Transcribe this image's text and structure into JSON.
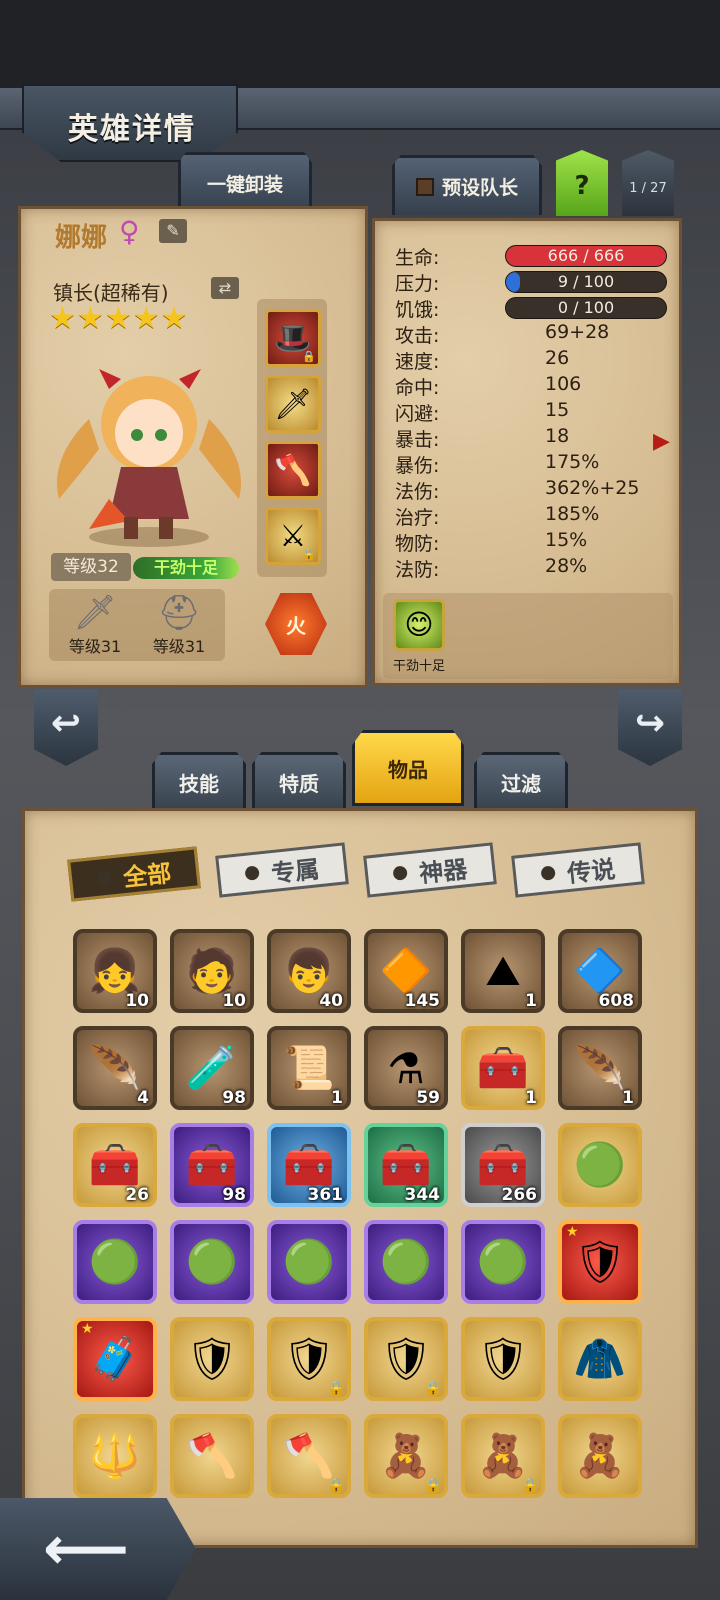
{
  "header": {
    "title": "英雄详情"
  },
  "top_buttons": {
    "unload_label": "一键卸装",
    "leader_label": "预设队长",
    "help_label": "?",
    "hero_index": "1 / 27"
  },
  "hero": {
    "name": "娜娜",
    "gender_icon": "female-icon",
    "title": "镇长(超稀有)",
    "stars": 5,
    "level_label": "等级32",
    "status": "干劲十足",
    "element": "火",
    "weapon_level": "等级31",
    "armor_level": "等级31",
    "equipment_slots": [
      "wizard-hat-icon",
      "sword-icon",
      "axe-icon",
      "scythe-icon"
    ]
  },
  "stats": {
    "hp": {
      "label": "生命:",
      "value": "666 / 666",
      "fill": 1.0,
      "color": "#d8333a"
    },
    "pressure": {
      "label": "压力:",
      "value": "9 / 100",
      "fill": 0.09,
      "color": "#2f6fd8"
    },
    "hunger": {
      "label": "饥饿:",
      "value": "0 / 100",
      "fill": 0.0,
      "color": "#c48a2a"
    },
    "rows": [
      {
        "label": "攻击:",
        "value": "69+28"
      },
      {
        "label": "速度:",
        "value": "26"
      },
      {
        "label": "命中:",
        "value": "106"
      },
      {
        "label": "闪避:",
        "value": "15"
      },
      {
        "label": "暴击:",
        "value": "18"
      },
      {
        "label": "暴伤:",
        "value": "175%"
      },
      {
        "label": "法伤:",
        "value": "362%+25"
      },
      {
        "label": "治疗:",
        "value": "185%"
      },
      {
        "label": "物防:",
        "value": "15%"
      },
      {
        "label": "法防:",
        "value": "28%"
      }
    ],
    "trait_label": "干劲十足"
  },
  "tabs": [
    {
      "label": "技能",
      "active": false
    },
    {
      "label": "特质",
      "active": false
    },
    {
      "label": "物品",
      "active": true
    },
    {
      "label": "过滤",
      "active": false
    }
  ],
  "filters": [
    {
      "label": "全部",
      "active": true
    },
    {
      "label": "专属",
      "active": false
    },
    {
      "label": "神器",
      "active": false
    },
    {
      "label": "传说",
      "active": false
    }
  ],
  "items": [
    {
      "icon": "hero-portrait-icon",
      "glyph": "👧",
      "count": "10",
      "bg": "brown"
    },
    {
      "icon": "hero-portrait-icon",
      "glyph": "🧑",
      "count": "10",
      "bg": "brown"
    },
    {
      "icon": "hero-portrait-icon",
      "glyph": "👦",
      "count": "40",
      "bg": "brown"
    },
    {
      "icon": "gem-icon",
      "glyph": "🔶",
      "count": "145",
      "bg": "brown"
    },
    {
      "icon": "ore-pile-icon",
      "glyph": "⛰",
      "count": "1",
      "bg": "brown"
    },
    {
      "icon": "rune-stone-icon",
      "glyph": "🔷",
      "count": "608",
      "bg": "brown"
    },
    {
      "icon": "feather-icon",
      "glyph": "🪶",
      "count": "4",
      "bg": "brown"
    },
    {
      "icon": "potion-icon",
      "glyph": "🧪",
      "count": "98",
      "bg": "brown"
    },
    {
      "icon": "scroll-icon",
      "glyph": "📜",
      "count": "1",
      "bg": "brown"
    },
    {
      "icon": "flask-icon",
      "glyph": "⚗",
      "count": "59",
      "bg": "brown"
    },
    {
      "icon": "chest-icon",
      "glyph": "🧰",
      "count": "1",
      "bg": "gold"
    },
    {
      "icon": "white-feather-icon",
      "glyph": "🪶",
      "count": "1",
      "bg": "brown"
    },
    {
      "icon": "chest-icon",
      "glyph": "🧰",
      "count": "26",
      "bg": "gold"
    },
    {
      "icon": "chest-icon",
      "glyph": "🧰",
      "count": "98",
      "bg": "purple"
    },
    {
      "icon": "chest-icon",
      "glyph": "🧰",
      "count": "361",
      "bg": "blue"
    },
    {
      "icon": "chest-icon",
      "glyph": "🧰",
      "count": "344",
      "bg": "green"
    },
    {
      "icon": "chest-icon",
      "glyph": "🧰",
      "count": "266",
      "bg": "gray"
    },
    {
      "icon": "green-orb-icon",
      "glyph": "🟢",
      "count": "",
      "bg": "gold"
    },
    {
      "icon": "green-orb-icon",
      "glyph": "🟢",
      "count": "",
      "bg": "purple"
    },
    {
      "icon": "green-orb-icon",
      "glyph": "🟢",
      "count": "",
      "bg": "purple"
    },
    {
      "icon": "green-orb-icon",
      "glyph": "🟢",
      "count": "",
      "bg": "purple"
    },
    {
      "icon": "green-orb-icon",
      "glyph": "🟢",
      "count": "",
      "bg": "purple"
    },
    {
      "icon": "green-orb-icon",
      "glyph": "🟢",
      "count": "",
      "bg": "purple"
    },
    {
      "icon": "armor-set-icon",
      "glyph": "🛡",
      "count": "",
      "bg": "red",
      "star": true
    },
    {
      "icon": "medkit-icon",
      "glyph": "🧳",
      "count": "",
      "bg": "red",
      "star": true
    },
    {
      "icon": "shield-icon",
      "glyph": "🛡",
      "count": "",
      "bg": "gold"
    },
    {
      "icon": "shield-icon",
      "glyph": "🛡",
      "count": "",
      "bg": "gold",
      "locked": true
    },
    {
      "icon": "shield-icon",
      "glyph": "🛡",
      "count": "",
      "bg": "gold",
      "locked": true
    },
    {
      "icon": "shield-icon",
      "glyph": "🛡",
      "count": "",
      "bg": "gold"
    },
    {
      "icon": "cloak-icon",
      "glyph": "🧥",
      "count": "",
      "bg": "gold"
    },
    {
      "icon": "blue-relic-icon",
      "glyph": "🔱",
      "count": "",
      "bg": "gold"
    },
    {
      "icon": "red-axe-icon",
      "glyph": "🪓",
      "count": "",
      "bg": "gold"
    },
    {
      "icon": "red-axe-icon",
      "glyph": "🪓",
      "count": "",
      "bg": "gold",
      "locked": true
    },
    {
      "icon": "voodoo-doll-icon",
      "glyph": "🧸",
      "count": "",
      "bg": "gold",
      "locked": true
    },
    {
      "icon": "voodoo-doll-icon",
      "glyph": "🧸",
      "count": "",
      "bg": "gold",
      "locked": true
    },
    {
      "icon": "voodoo-doll-icon",
      "glyph": "🧸",
      "count": "",
      "bg": "gold"
    }
  ],
  "back_label": "⟵"
}
